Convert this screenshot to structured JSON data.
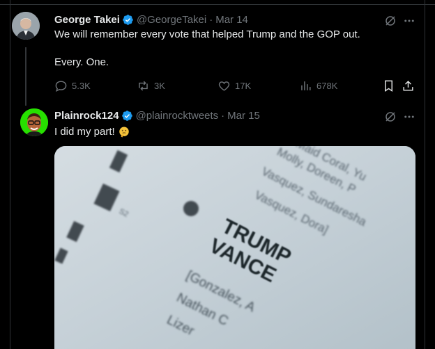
{
  "tweets": [
    {
      "display_name": "George Takei",
      "handle": "@GeorgeTakei",
      "separator": "·",
      "date": "Mar 14",
      "text_line1": "We will remember every vote that helped Trump and the GOP out.",
      "text_line2": "Every. One.",
      "replies": "5.3K",
      "reposts": "3K",
      "likes": "17K",
      "views": "678K"
    },
    {
      "display_name": "Plainrock124",
      "handle": "@plainrocktweets",
      "separator": "·",
      "date": "Mar 15",
      "text": "I did my part!"
    }
  ],
  "ballot_image": {
    "lines": [
      "TRUMP",
      "VANCE",
      "[Gonzalez, A",
      "Nathan C",
      "Lizer"
    ],
    "top_lines": [
      "Maid Coral, Yu",
      "Molly, Doreen, P",
      "Vasquez, Sundaresha",
      "Vasquez, Dora]"
    ]
  },
  "colors": {
    "background": "#000000",
    "text": "#e7e9ea",
    "muted": "#71767b",
    "verified": "#1d9bf0",
    "border": "#2f3336"
  },
  "icons": {
    "grok": "grok-icon",
    "more": "more-icon",
    "reply": "reply-icon",
    "repost": "repost-icon",
    "like": "like-icon",
    "views": "views-icon",
    "bookmark": "bookmark-icon",
    "share": "share-icon",
    "emoji": "thinking-face-emoji"
  }
}
